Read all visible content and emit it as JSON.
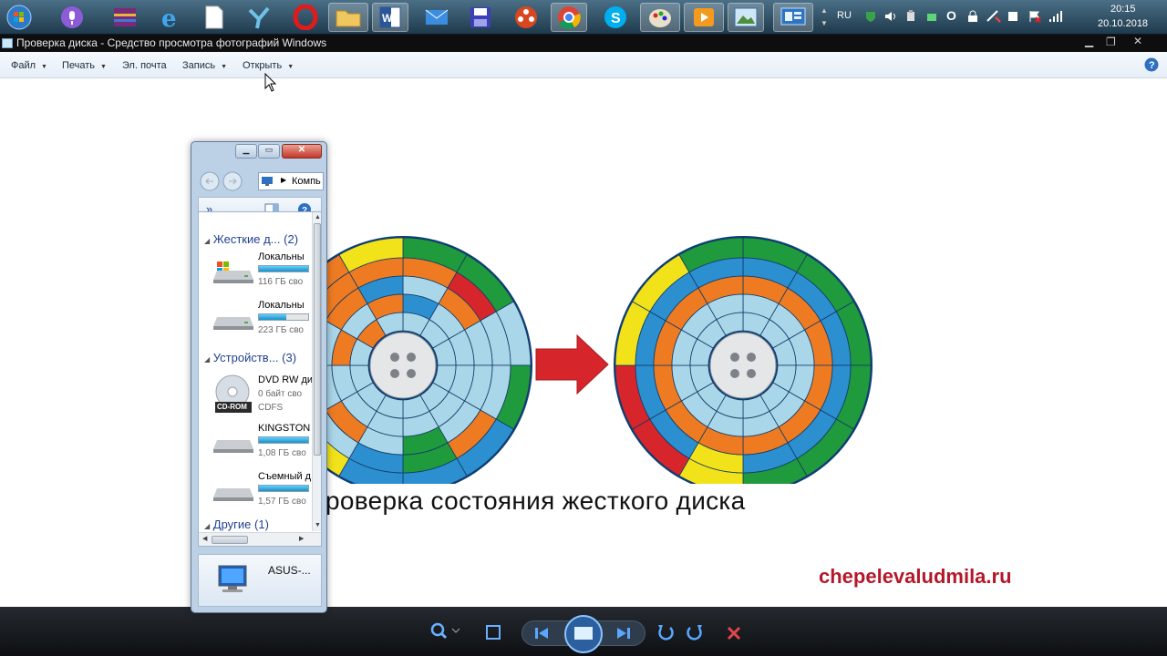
{
  "taskbar": {
    "icons": [
      "start-orb-icon",
      "microphone-icon",
      "winrar-icon",
      "internet-explorer-icon",
      "blank-document-icon",
      "yandex-browser-icon",
      "opera-icon",
      "folder-icon",
      "word-icon",
      "mail-icon",
      "save-disk-icon",
      "media-reel-icon",
      "chrome-icon",
      "skype-icon",
      "paint-icon",
      "video-player-icon",
      "photo-viewer-icon",
      "remote-control-icon"
    ]
  },
  "tray": {
    "language": "RU",
    "time": "20:15",
    "date": "20.10.2018"
  },
  "window": {
    "title": "Проверка диска - Средство просмотра фотографий Windows"
  },
  "menu": {
    "file": "Файл",
    "print": "Печать",
    "email": "Эл. почта",
    "burn": "Запись",
    "open": "Открыть"
  },
  "photo": {
    "caption": "роверка состояния жесткого диска"
  },
  "watermark": "chepelevaludmila.ru",
  "explorer": {
    "address": "Компь",
    "nav_more": "»",
    "groups": {
      "hard": "Жесткие д... (2)",
      "devices": "Устройств... (3)",
      "other": "Другие (1)"
    },
    "drives": [
      {
        "name": "Локальны",
        "sub": "116 ГБ сво",
        "fill": 1.0
      },
      {
        "name": "Локальны",
        "sub": "223 ГБ сво",
        "fill": 0.55
      },
      {
        "name": "DVD RW ди",
        "sub": "0 байт сво",
        "sub2": "CDFS",
        "label": "CD-ROM"
      },
      {
        "name": "KINGSTON",
        "sub": "1,08 ГБ сво",
        "fill": 1.0
      },
      {
        "name": "Съемный д",
        "sub": "1,57 ГБ сво",
        "fill": 1.0
      }
    ],
    "computer": "ASUS-..."
  },
  "colors": {
    "green": "#1f9a3c",
    "blue": "#2b8fd0",
    "orange": "#ee7b22",
    "yellow": "#f2e21a",
    "red": "#d7262b",
    "light": "#a9d6e8",
    "watermark": "#b3192a"
  }
}
